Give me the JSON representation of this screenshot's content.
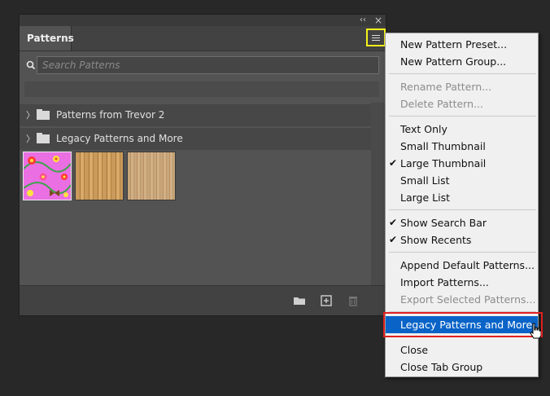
{
  "panel": {
    "tab_title": "Patterns",
    "collapse_glyph": "‹‹",
    "close_glyph": "×",
    "search": {
      "placeholder": "Search Patterns",
      "value": ""
    },
    "groups": [
      {
        "label": "Patterns from Trevor 2"
      },
      {
        "label": "Legacy Patterns and More"
      }
    ],
    "thumbnails": [
      {
        "name": "flowers-pattern",
        "selected": true
      },
      {
        "name": "wood-pattern-1",
        "selected": false
      },
      {
        "name": "wood-pattern-2",
        "selected": false
      }
    ]
  },
  "menu": {
    "items": [
      {
        "label": "New Pattern Preset...",
        "enabled": true,
        "checked": false
      },
      {
        "label": "New Pattern Group...",
        "enabled": true,
        "checked": false
      },
      {
        "label": "Rename Pattern...",
        "enabled": false,
        "checked": false
      },
      {
        "label": "Delete Pattern...",
        "enabled": false,
        "checked": false
      },
      {
        "label": "Text Only",
        "enabled": true,
        "checked": false
      },
      {
        "label": "Small Thumbnail",
        "enabled": true,
        "checked": false
      },
      {
        "label": "Large Thumbnail",
        "enabled": true,
        "checked": true
      },
      {
        "label": "Small List",
        "enabled": true,
        "checked": false
      },
      {
        "label": "Large List",
        "enabled": true,
        "checked": false
      },
      {
        "label": "Show Search Bar",
        "enabled": true,
        "checked": true
      },
      {
        "label": "Show Recents",
        "enabled": true,
        "checked": true
      },
      {
        "label": "Append Default Patterns...",
        "enabled": true,
        "checked": false
      },
      {
        "label": "Import Patterns...",
        "enabled": true,
        "checked": false
      },
      {
        "label": "Export Selected Patterns...",
        "enabled": false,
        "checked": false
      },
      {
        "label": "Legacy Patterns and More",
        "enabled": true,
        "checked": false,
        "highlighted": true
      },
      {
        "label": "Close",
        "enabled": true,
        "checked": false
      },
      {
        "label": "Close Tab Group",
        "enabled": true,
        "checked": false
      }
    ],
    "check_glyph": "✔"
  },
  "colors": {
    "highlight": "#0a64c8",
    "callout_yellow": "#f4f11a",
    "callout_red": "#e02020"
  }
}
